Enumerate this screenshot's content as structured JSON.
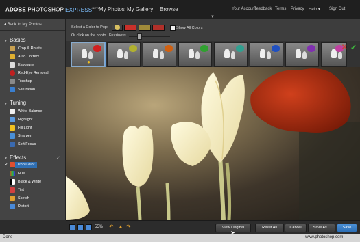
{
  "header": {
    "brand": "ADOBE",
    "product": "PHOTOSHOP",
    "edition": "EXPRESS",
    "beta": "BETA",
    "nav": [
      "My Photos",
      "My Gallery",
      "Browse"
    ],
    "right_links": [
      "Your Account",
      "Feedback",
      "Terms",
      "Privacy",
      "Help ▾",
      "Sign Out"
    ]
  },
  "sidebar": {
    "back_label": "Back to My Photos",
    "sections": [
      {
        "title": "Basics",
        "items": [
          "Crop & Rotate",
          "Auto Correct",
          "Exposure",
          "Red-Eye Removal",
          "Touchup",
          "Saturation"
        ]
      },
      {
        "title": "Tuning",
        "items": [
          "White Balance",
          "Highlight",
          "Fill Light",
          "Sharpen",
          "Soft Focus"
        ]
      },
      {
        "title": "Effects",
        "items": [
          "Pop Color",
          "Hue",
          "Black & White",
          "Tint",
          "Sketch",
          "Distort"
        ]
      }
    ],
    "selected_item": "Pop Color"
  },
  "options": {
    "select_label": "Select a Color to Pop:",
    "click_label": "Or click on the photo.",
    "fuzziness_label": "Fuzziness",
    "show_all_label": "Show All Colors",
    "swatch_colors": [
      "#d8c060",
      "#c8302a",
      "#a08a3a",
      "#b0302a"
    ]
  },
  "thumbnails": {
    "colors": [
      "#d02020",
      "#b0b030",
      "#d06010",
      "#30a030",
      "#30a090",
      "#2050c0",
      "#8030b0",
      "#c040a0"
    ],
    "selected_index": 0
  },
  "bottom": {
    "zoom": "55%",
    "buttons": [
      "View Original",
      "Reset All",
      "Cancel",
      "Save As...",
      "Save"
    ]
  },
  "status": {
    "left": "Done",
    "right": "www.photoshop.com"
  },
  "colors": {
    "accent": "#2f6fb3",
    "confirm": "#3fbf3f",
    "cancel": "#d23a3a"
  }
}
